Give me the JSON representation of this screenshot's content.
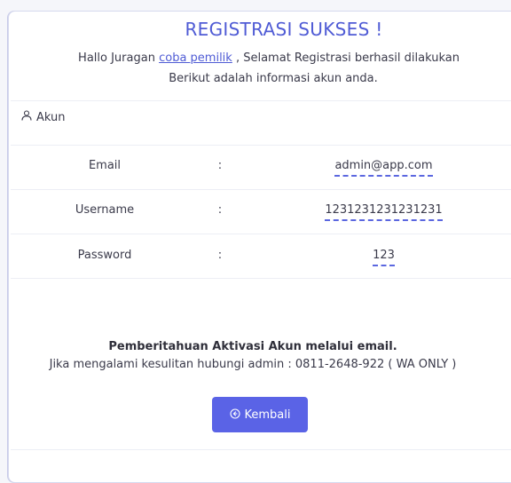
{
  "header": {
    "title": "REGISTRASI SUKSES !",
    "greeting_prefix": "Hallo Juragan",
    "user_link": "coba pemilik",
    "greeting_suffix": ", Selamat Registrasi berhasil dilakukan",
    "info_line": "Berikut adalah informasi akun anda."
  },
  "section": {
    "icon": "user-icon",
    "label": "Akun"
  },
  "account": [
    {
      "key": "Email",
      "sep": ":",
      "value": "admin@app.com"
    },
    {
      "key": "Username",
      "sep": ":",
      "value": "1231231231231231"
    },
    {
      "key": "Password",
      "sep": ":",
      "value": "123"
    }
  ],
  "notice": {
    "title": "Pemberitahuan Aktivasi Akun melalui email.",
    "contact": "Jika mengalami kesulitan hubungi admin : 0811-2648-922 ( WA ONLY )"
  },
  "button": {
    "icon": "arrow-circle-left-icon",
    "label": "Kembali"
  },
  "colors": {
    "accent": "#5a63e6",
    "title": "#4f5bd5"
  }
}
